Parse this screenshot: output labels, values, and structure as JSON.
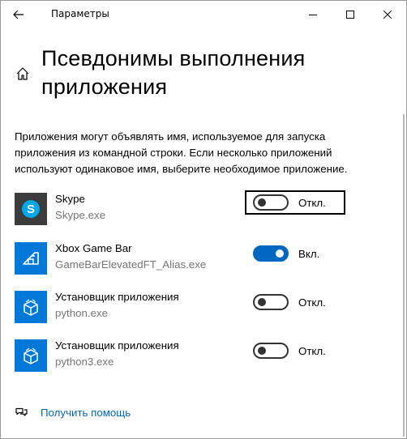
{
  "window": {
    "title": "Параметры"
  },
  "page": {
    "title": "Псевдонимы выполнения приложения",
    "description": "Приложения могут объявлять имя, используемое для запуска приложения из командной строки. Если несколько приложений используют одинаковое имя, выберите необходимое приложение."
  },
  "apps": [
    {
      "name": "Skype",
      "exe": "Skype.exe",
      "icon": "skype-icon",
      "state": "Откл.",
      "on": false,
      "focused": true
    },
    {
      "name": "Xbox Game Bar",
      "exe": "GameBarElevatedFT_Alias.exe",
      "icon": "xbox-game-bar-icon",
      "state": "Вкл.",
      "on": true,
      "focused": false
    },
    {
      "name": "Установщик приложения",
      "exe": "python.exe",
      "icon": "app-installer-icon",
      "state": "Откл.",
      "on": false,
      "focused": false
    },
    {
      "name": "Установщик приложения",
      "exe": "python3.exe",
      "icon": "app-installer-icon",
      "state": "Откл.",
      "on": false,
      "focused": false
    }
  ],
  "help": {
    "label": "Получить помощь"
  },
  "colors": {
    "accent": "#0067c0",
    "skype_bg": "#3c3c3c",
    "skype_blue": "#00a8e8",
    "tile_blue": "#0078d7",
    "link": "#0067b8"
  }
}
